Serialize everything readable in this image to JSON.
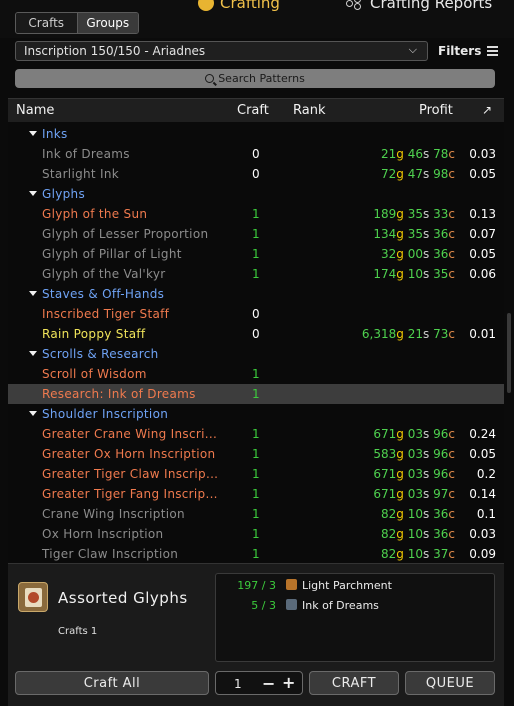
{
  "topbar": {
    "seg_crafts": "Crafts",
    "seg_groups": "Groups",
    "tab_crafting": "Crafting",
    "tab_reports": "Crafting Reports"
  },
  "profession_dropdown": {
    "value": "Inscription 150/150 - Ariadnes"
  },
  "filters_label": "Filters",
  "search": {
    "placeholder": "Search Patterns"
  },
  "columns": {
    "name": "Name",
    "craft": "Craft",
    "rank": "Rank",
    "profit": "Profit",
    "sort_glyph": "↗"
  },
  "rows": [
    {
      "type": "category",
      "name": "Inks"
    },
    {
      "type": "item",
      "name": "Ink of Dreams",
      "color": "gray",
      "craft": "0",
      "gold": "21",
      "silver": "46",
      "copper": "78",
      "rank": "0.03"
    },
    {
      "type": "item",
      "name": "Starlight Ink",
      "color": "gray",
      "craft": "0",
      "gold": "72",
      "silver": "47",
      "copper": "98",
      "rank": "0.05"
    },
    {
      "type": "category",
      "name": "Glyphs"
    },
    {
      "type": "item",
      "name": "Glyph of the Sun",
      "color": "orange",
      "craft": "1",
      "gold": "189",
      "silver": "35",
      "copper": "33",
      "rank": "0.13"
    },
    {
      "type": "item",
      "name": "Glyph of Lesser Proportion",
      "color": "gray",
      "craft": "1",
      "gold": "134",
      "silver": "35",
      "copper": "36",
      "rank": "0.07"
    },
    {
      "type": "item",
      "name": "Glyph of Pillar of Light",
      "color": "gray",
      "craft": "1",
      "gold": "32",
      "silver": "00",
      "copper": "36",
      "rank": "0.05"
    },
    {
      "type": "item",
      "name": "Glyph of the Val'kyr",
      "color": "gray",
      "craft": "1",
      "gold": "174",
      "silver": "10",
      "copper": "35",
      "rank": "0.06"
    },
    {
      "type": "category",
      "name": "Staves & Off-Hands"
    },
    {
      "type": "item",
      "name": "Inscribed Tiger Staff",
      "color": "orange",
      "craft": "0",
      "gold": "",
      "silver": "",
      "copper": "",
      "rank": ""
    },
    {
      "type": "item",
      "name": "Rain Poppy Staff",
      "color": "yellow",
      "craft": "0",
      "gold": "6,318",
      "silver": "21",
      "copper": "73",
      "rank": "0.01"
    },
    {
      "type": "category",
      "name": "Scrolls & Research"
    },
    {
      "type": "item",
      "name": "Scroll of Wisdom",
      "color": "orange",
      "craft": "1",
      "gold": "",
      "silver": "",
      "copper": "",
      "rank": ""
    },
    {
      "type": "item",
      "name": "Research: Ink of Dreams",
      "color": "orange",
      "craft": "1",
      "gold": "",
      "silver": "",
      "copper": "",
      "rank": "",
      "selected": true
    },
    {
      "type": "category",
      "name": "Shoulder Inscription"
    },
    {
      "type": "item",
      "name": "Greater Crane Wing Inscri...",
      "color": "orange",
      "craft": "1",
      "gold": "671",
      "silver": "03",
      "copper": "96",
      "rank": "0.24"
    },
    {
      "type": "item",
      "name": "Greater Ox Horn Inscription",
      "color": "orange",
      "craft": "1",
      "gold": "583",
      "silver": "03",
      "copper": "96",
      "rank": "0.05"
    },
    {
      "type": "item",
      "name": "Greater Tiger Claw Inscrip...",
      "color": "orange",
      "craft": "1",
      "gold": "671",
      "silver": "03",
      "copper": "96",
      "rank": "0.2"
    },
    {
      "type": "item",
      "name": "Greater Tiger Fang Inscrip...",
      "color": "orange",
      "craft": "1",
      "gold": "671",
      "silver": "03",
      "copper": "97",
      "rank": "0.14"
    },
    {
      "type": "item",
      "name": "Crane Wing Inscription",
      "color": "gray",
      "craft": "1",
      "gold": "82",
      "silver": "10",
      "copper": "36",
      "rank": "0.1"
    },
    {
      "type": "item",
      "name": "Ox Horn Inscription",
      "color": "gray",
      "craft": "1",
      "gold": "82",
      "silver": "10",
      "copper": "36",
      "rank": "0.03"
    },
    {
      "type": "item",
      "name": "Tiger Claw Inscription",
      "color": "gray",
      "craft": "1",
      "gold": "82",
      "silver": "10",
      "copper": "37",
      "rank": "0.09"
    }
  ],
  "recipe": {
    "title": "Assorted Glyphs",
    "crafts": "Crafts 1",
    "mats": [
      {
        "qty": "197 / 3",
        "name": "Light Parchment",
        "icon": "parchment-icon",
        "icon_color": "#b8742a"
      },
      {
        "qty": "5 / 3",
        "name": "Ink of Dreams",
        "icon": "ink-icon",
        "icon_color": "#5a6a7a"
      }
    ]
  },
  "actions": {
    "craft_all": "Craft All",
    "quantity": "1",
    "minus": "−",
    "plus": "+",
    "craft": "CRAFT",
    "queue": "QUEUE"
  }
}
